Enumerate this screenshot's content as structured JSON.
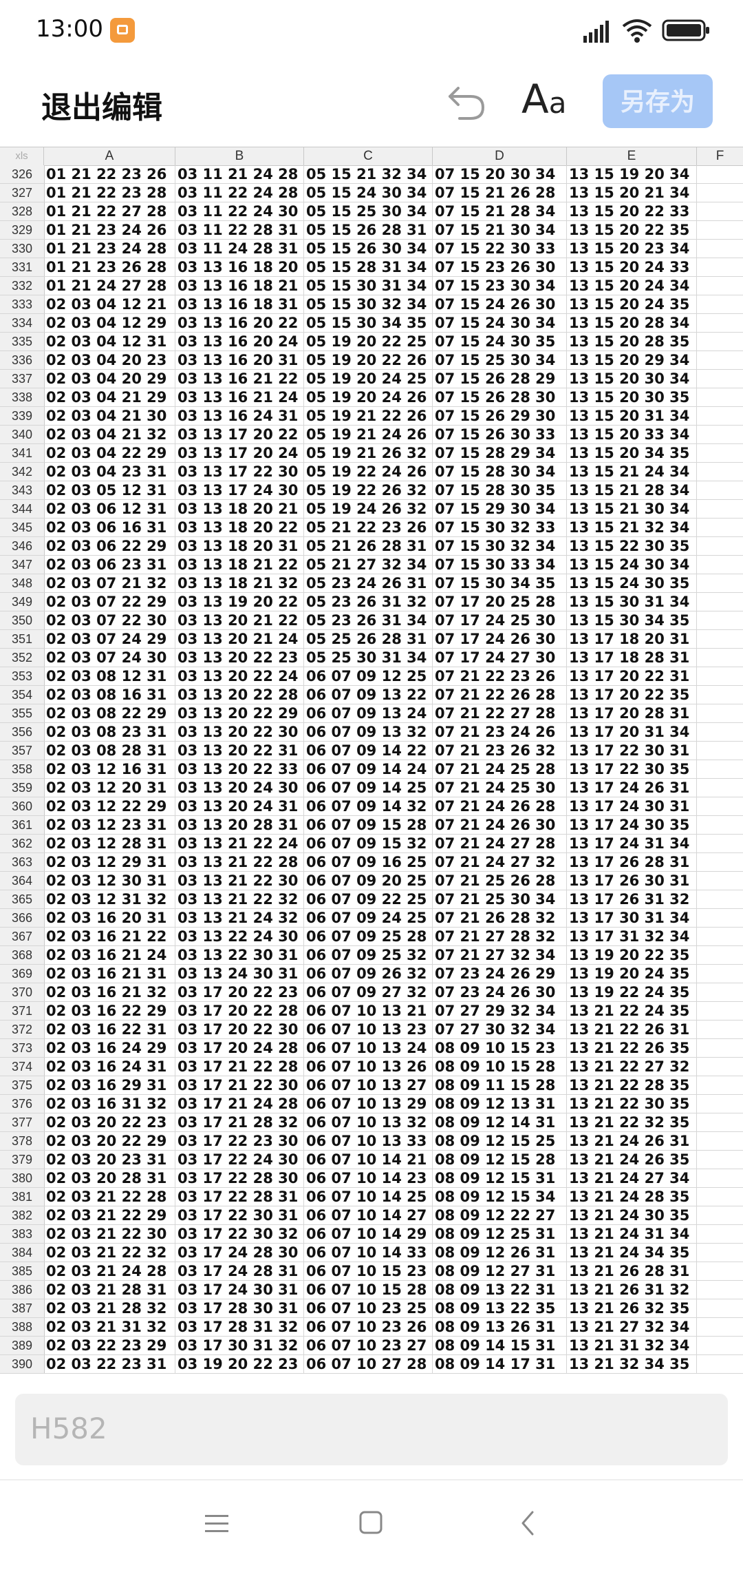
{
  "status": {
    "time": "13:00"
  },
  "toolbar": {
    "exit_label": "退出编辑",
    "font_label_big": "A",
    "font_label_small": "a",
    "save_as_label": "另存为"
  },
  "sheet": {
    "corner": "xls",
    "columns": [
      "A",
      "B",
      "C",
      "D",
      "E",
      "F"
    ],
    "rows": [
      {
        "n": "326",
        "c": [
          "01 21 22 23 26",
          "03 11 21 24 28",
          "05 15 21 32 34",
          "07 15 20 30 34",
          "13 15 19 20 34"
        ]
      },
      {
        "n": "327",
        "c": [
          "01 21 22 23 28",
          "03 11 22 24 28",
          "05 15 24 30 34",
          "07 15 21 26 28",
          "13 15 20 21 34"
        ]
      },
      {
        "n": "328",
        "c": [
          "01 21 22 27 28",
          "03 11 22 24 30",
          "05 15 25 30 34",
          "07 15 21 28 34",
          "13 15 20 22 33"
        ]
      },
      {
        "n": "329",
        "c": [
          "01 21 23 24 26",
          "03 11 22 28 31",
          "05 15 26 28 31",
          "07 15 21 30 34",
          "13 15 20 22 35"
        ]
      },
      {
        "n": "330",
        "c": [
          "01 21 23 24 28",
          "03 11 24 28 31",
          "05 15 26 30 34",
          "07 15 22 30 33",
          "13 15 20 23 34"
        ]
      },
      {
        "n": "331",
        "c": [
          "01 21 23 26 28",
          "03 13 16 18 20",
          "05 15 28 31 34",
          "07 15 23 26 30",
          "13 15 20 24 33"
        ]
      },
      {
        "n": "332",
        "c": [
          "01 21 24 27 28",
          "03 13 16 18 21",
          "05 15 30 31 34",
          "07 15 23 30 34",
          "13 15 20 24 34"
        ]
      },
      {
        "n": "333",
        "c": [
          "02 03 04 12 21",
          "03 13 16 18 31",
          "05 15 30 32 34",
          "07 15 24 26 30",
          "13 15 20 24 35"
        ]
      },
      {
        "n": "334",
        "c": [
          "02 03 04 12 29",
          "03 13 16 20 22",
          "05 15 30 34 35",
          "07 15 24 30 34",
          "13 15 20 28 34"
        ]
      },
      {
        "n": "335",
        "c": [
          "02 03 04 12 31",
          "03 13 16 20 24",
          "05 19 20 22 25",
          "07 15 24 30 35",
          "13 15 20 28 35"
        ]
      },
      {
        "n": "336",
        "c": [
          "02 03 04 20 23",
          "03 13 16 20 31",
          "05 19 20 22 26",
          "07 15 25 30 34",
          "13 15 20 29 34"
        ]
      },
      {
        "n": "337",
        "c": [
          "02 03 04 20 29",
          "03 13 16 21 22",
          "05 19 20 24 25",
          "07 15 26 28 29",
          "13 15 20 30 34"
        ]
      },
      {
        "n": "338",
        "c": [
          "02 03 04 21 29",
          "03 13 16 21 24",
          "05 19 20 24 26",
          "07 15 26 28 30",
          "13 15 20 30 35"
        ]
      },
      {
        "n": "339",
        "c": [
          "02 03 04 21 30",
          "03 13 16 24 31",
          "05 19 21 22 26",
          "07 15 26 29 30",
          "13 15 20 31 34"
        ]
      },
      {
        "n": "340",
        "c": [
          "02 03 04 21 32",
          "03 13 17 20 22",
          "05 19 21 24 26",
          "07 15 26 30 33",
          "13 15 20 33 34"
        ]
      },
      {
        "n": "341",
        "c": [
          "02 03 04 22 29",
          "03 13 17 20 24",
          "05 19 21 26 32",
          "07 15 28 29 34",
          "13 15 20 34 35"
        ]
      },
      {
        "n": "342",
        "c": [
          "02 03 04 23 31",
          "03 13 17 22 30",
          "05 19 22 24 26",
          "07 15 28 30 34",
          "13 15 21 24 34"
        ]
      },
      {
        "n": "343",
        "c": [
          "02 03 05 12 31",
          "03 13 17 24 30",
          "05 19 22 26 32",
          "07 15 28 30 35",
          "13 15 21 28 34"
        ]
      },
      {
        "n": "344",
        "c": [
          "02 03 06 12 31",
          "03 13 18 20 21",
          "05 19 24 26 32",
          "07 15 29 30 34",
          "13 15 21 30 34"
        ]
      },
      {
        "n": "345",
        "c": [
          "02 03 06 16 31",
          "03 13 18 20 22",
          "05 21 22 23 26",
          "07 15 30 32 33",
          "13 15 21 32 34"
        ]
      },
      {
        "n": "346",
        "c": [
          "02 03 06 22 29",
          "03 13 18 20 31",
          "05 21 26 28 31",
          "07 15 30 32 34",
          "13 15 22 30 35"
        ]
      },
      {
        "n": "347",
        "c": [
          "02 03 06 23 31",
          "03 13 18 21 22",
          "05 21 27 32 34",
          "07 15 30 33 34",
          "13 15 24 30 34"
        ]
      },
      {
        "n": "348",
        "c": [
          "02 03 07 21 32",
          "03 13 18 21 32",
          "05 23 24 26 31",
          "07 15 30 34 35",
          "13 15 24 30 35"
        ]
      },
      {
        "n": "349",
        "c": [
          "02 03 07 22 29",
          "03 13 19 20 22",
          "05 23 26 31 32",
          "07 17 20 25 28",
          "13 15 30 31 34"
        ]
      },
      {
        "n": "350",
        "c": [
          "02 03 07 22 30",
          "03 13 20 21 22",
          "05 23 26 31 34",
          "07 17 24 25 30",
          "13 15 30 34 35"
        ]
      },
      {
        "n": "351",
        "c": [
          "02 03 07 24 29",
          "03 13 20 21 24",
          "05 25 26 28 31",
          "07 17 24 26 30",
          "13 17 18 20 31"
        ]
      },
      {
        "n": "352",
        "c": [
          "02 03 07 24 30",
          "03 13 20 22 23",
          "05 25 30 31 34",
          "07 17 24 27 30",
          "13 17 18 28 31"
        ]
      },
      {
        "n": "353",
        "c": [
          "02 03 08 12 31",
          "03 13 20 22 24",
          "06 07 09 12 25",
          "07 21 22 23 26",
          "13 17 20 22 31"
        ]
      },
      {
        "n": "354",
        "c": [
          "02 03 08 16 31",
          "03 13 20 22 28",
          "06 07 09 13 22",
          "07 21 22 26 28",
          "13 17 20 22 35"
        ]
      },
      {
        "n": "355",
        "c": [
          "02 03 08 22 29",
          "03 13 20 22 29",
          "06 07 09 13 24",
          "07 21 22 27 28",
          "13 17 20 28 31"
        ]
      },
      {
        "n": "356",
        "c": [
          "02 03 08 23 31",
          "03 13 20 22 30",
          "06 07 09 13 32",
          "07 21 23 24 26",
          "13 17 20 31 34"
        ]
      },
      {
        "n": "357",
        "c": [
          "02 03 08 28 31",
          "03 13 20 22 31",
          "06 07 09 14 22",
          "07 21 23 26 32",
          "13 17 22 30 31"
        ]
      },
      {
        "n": "358",
        "c": [
          "02 03 12 16 31",
          "03 13 20 22 33",
          "06 07 09 14 24",
          "07 21 24 25 28",
          "13 17 22 30 35"
        ]
      },
      {
        "n": "359",
        "c": [
          "02 03 12 20 31",
          "03 13 20 24 30",
          "06 07 09 14 25",
          "07 21 24 25 30",
          "13 17 24 26 31"
        ]
      },
      {
        "n": "360",
        "c": [
          "02 03 12 22 29",
          "03 13 20 24 31",
          "06 07 09 14 32",
          "07 21 24 26 28",
          "13 17 24 30 31"
        ]
      },
      {
        "n": "361",
        "c": [
          "02 03 12 23 31",
          "03 13 20 28 31",
          "06 07 09 15 28",
          "07 21 24 26 30",
          "13 17 24 30 35"
        ]
      },
      {
        "n": "362",
        "c": [
          "02 03 12 28 31",
          "03 13 21 22 24",
          "06 07 09 15 32",
          "07 21 24 27 28",
          "13 17 24 31 34"
        ]
      },
      {
        "n": "363",
        "c": [
          "02 03 12 29 31",
          "03 13 21 22 28",
          "06 07 09 16 25",
          "07 21 24 27 32",
          "13 17 26 28 31"
        ]
      },
      {
        "n": "364",
        "c": [
          "02 03 12 30 31",
          "03 13 21 22 30",
          "06 07 09 20 25",
          "07 21 25 26 28",
          "13 17 26 30 31"
        ]
      },
      {
        "n": "365",
        "c": [
          "02 03 12 31 32",
          "03 13 21 22 32",
          "06 07 09 22 25",
          "07 21 25 30 34",
          "13 17 26 31 32"
        ]
      },
      {
        "n": "366",
        "c": [
          "02 03 16 20 31",
          "03 13 21 24 32",
          "06 07 09 24 25",
          "07 21 26 28 32",
          "13 17 30 31 34"
        ]
      },
      {
        "n": "367",
        "c": [
          "02 03 16 21 22",
          "03 13 22 24 30",
          "06 07 09 25 28",
          "07 21 27 28 32",
          "13 17 31 32 34"
        ]
      },
      {
        "n": "368",
        "c": [
          "02 03 16 21 24",
          "03 13 22 30 31",
          "06 07 09 25 32",
          "07 21 27 32 34",
          "13 19 20 22 35"
        ]
      },
      {
        "n": "369",
        "c": [
          "02 03 16 21 31",
          "03 13 24 30 31",
          "06 07 09 26 32",
          "07 23 24 26 29",
          "13 19 20 24 35"
        ]
      },
      {
        "n": "370",
        "c": [
          "02 03 16 21 32",
          "03 17 20 22 23",
          "06 07 09 27 32",
          "07 23 24 26 30",
          "13 19 22 24 35"
        ]
      },
      {
        "n": "371",
        "c": [
          "02 03 16 22 29",
          "03 17 20 22 28",
          "06 07 10 13 21",
          "07 27 29 32 34",
          "13 21 22 24 35"
        ]
      },
      {
        "n": "372",
        "c": [
          "02 03 16 22 31",
          "03 17 20 22 30",
          "06 07 10 13 23",
          "07 27 30 32 34",
          "13 21 22 26 31"
        ]
      },
      {
        "n": "373",
        "c": [
          "02 03 16 24 29",
          "03 17 20 24 28",
          "06 07 10 13 24",
          "08 09 10 15 23",
          "13 21 22 26 35"
        ]
      },
      {
        "n": "374",
        "c": [
          "02 03 16 24 31",
          "03 17 21 22 28",
          "06 07 10 13 26",
          "08 09 10 15 28",
          "13 21 22 27 32"
        ]
      },
      {
        "n": "375",
        "c": [
          "02 03 16 29 31",
          "03 17 21 22 30",
          "06 07 10 13 27",
          "08 09 11 15 28",
          "13 21 22 28 35"
        ]
      },
      {
        "n": "376",
        "c": [
          "02 03 16 31 32",
          "03 17 21 24 28",
          "06 07 10 13 29",
          "08 09 12 13 31",
          "13 21 22 30 35"
        ]
      },
      {
        "n": "377",
        "c": [
          "02 03 20 22 23",
          "03 17 21 28 32",
          "06 07 10 13 32",
          "08 09 12 14 31",
          "13 21 22 32 35"
        ]
      },
      {
        "n": "378",
        "c": [
          "02 03 20 22 29",
          "03 17 22 23 30",
          "06 07 10 13 33",
          "08 09 12 15 25",
          "13 21 24 26 31"
        ]
      },
      {
        "n": "379",
        "c": [
          "02 03 20 23 31",
          "03 17 22 24 30",
          "06 07 10 14 21",
          "08 09 12 15 28",
          "13 21 24 26 35"
        ]
      },
      {
        "n": "380",
        "c": [
          "02 03 20 28 31",
          "03 17 22 28 30",
          "06 07 10 14 23",
          "08 09 12 15 31",
          "13 21 24 27 34"
        ]
      },
      {
        "n": "381",
        "c": [
          "02 03 21 22 28",
          "03 17 22 28 31",
          "06 07 10 14 25",
          "08 09 12 15 34",
          "13 21 24 28 35"
        ]
      },
      {
        "n": "382",
        "c": [
          "02 03 21 22 29",
          "03 17 22 30 31",
          "06 07 10 14 27",
          "08 09 12 22 27",
          "13 21 24 30 35"
        ]
      },
      {
        "n": "383",
        "c": [
          "02 03 21 22 30",
          "03 17 22 30 32",
          "06 07 10 14 29",
          "08 09 12 25 31",
          "13 21 24 31 34"
        ]
      },
      {
        "n": "384",
        "c": [
          "02 03 21 22 32",
          "03 17 24 28 30",
          "06 07 10 14 33",
          "08 09 12 26 31",
          "13 21 24 34 35"
        ]
      },
      {
        "n": "385",
        "c": [
          "02 03 21 24 28",
          "03 17 24 28 31",
          "06 07 10 15 23",
          "08 09 12 27 31",
          "13 21 26 28 31"
        ]
      },
      {
        "n": "386",
        "c": [
          "02 03 21 28 31",
          "03 17 24 30 31",
          "06 07 10 15 28",
          "08 09 13 22 31",
          "13 21 26 31 32"
        ]
      },
      {
        "n": "387",
        "c": [
          "02 03 21 28 32",
          "03 17 28 30 31",
          "06 07 10 23 25",
          "08 09 13 22 35",
          "13 21 26 32 35"
        ]
      },
      {
        "n": "388",
        "c": [
          "02 03 21 31 32",
          "03 17 28 31 32",
          "06 07 10 23 26",
          "08 09 13 26 31",
          "13 21 27 32 34"
        ]
      },
      {
        "n": "389",
        "c": [
          "02 03 22 23 29",
          "03 17 30 31 32",
          "06 07 10 23 27",
          "08 09 14 15 31",
          "13 21 31 32 34"
        ]
      },
      {
        "n": "390",
        "c": [
          "02 03 22 23 31",
          "03 19 20 22 23",
          "06 07 10 27 28",
          "08 09 14 17 31",
          "13 21 32 34 35"
        ]
      }
    ]
  },
  "formula_bar": {
    "value": "H582"
  },
  "icons": {
    "undo": "undo-icon",
    "menu": "menu-icon",
    "home": "home-icon",
    "back": "back-icon"
  },
  "colors": {
    "save_button": "#a6c7f6",
    "header_bg": "#f0f0f0"
  }
}
